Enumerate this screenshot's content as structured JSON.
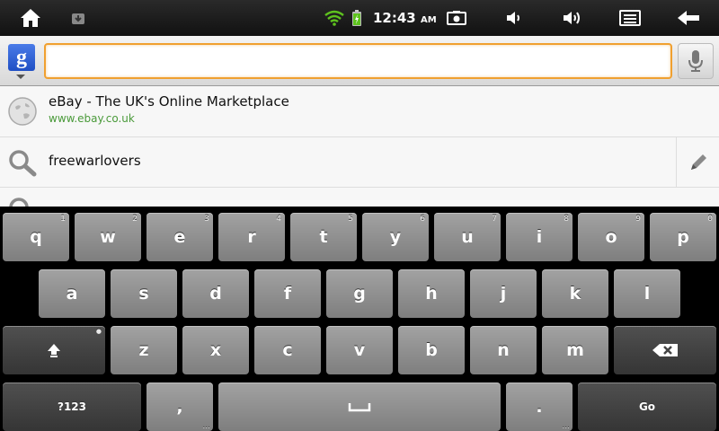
{
  "statusbar": {
    "time": "12:43",
    "ampm": "AM",
    "icons": [
      "home-icon",
      "download-icon",
      "wifi-icon",
      "battery-icon",
      "screenshot-icon",
      "volume-down-icon",
      "volume-up-icon",
      "menu-icon",
      "back-icon"
    ]
  },
  "search": {
    "provider_logo": "g",
    "query": "",
    "placeholder": ""
  },
  "suggestions": [
    {
      "type": "bookmark",
      "title": "eBay - The UK's Online Marketplace",
      "url": "www.ebay.co.uk"
    },
    {
      "type": "query",
      "title": "freewarlovers"
    }
  ],
  "keyboard": {
    "row1": [
      {
        "label": "q",
        "hint": "1"
      },
      {
        "label": "w",
        "hint": "2"
      },
      {
        "label": "e",
        "hint": "3"
      },
      {
        "label": "r",
        "hint": "4"
      },
      {
        "label": "t",
        "hint": "5"
      },
      {
        "label": "y",
        "hint": "6"
      },
      {
        "label": "u",
        "hint": "7"
      },
      {
        "label": "i",
        "hint": "8"
      },
      {
        "label": "o",
        "hint": "9"
      },
      {
        "label": "p",
        "hint": "0"
      }
    ],
    "row2": [
      "a",
      "s",
      "d",
      "f",
      "g",
      "h",
      "j",
      "k",
      "l"
    ],
    "row3": [
      "z",
      "x",
      "c",
      "v",
      "b",
      "n",
      "m"
    ],
    "symbols_label": "?123",
    "comma_label": ",",
    "period_label": ".",
    "go_label": "Go"
  },
  "colors": {
    "focus_border": "#f0a030",
    "url_green": "#4a9a3a",
    "key_light": "#9a9a9a",
    "key_dark": "#404040"
  }
}
